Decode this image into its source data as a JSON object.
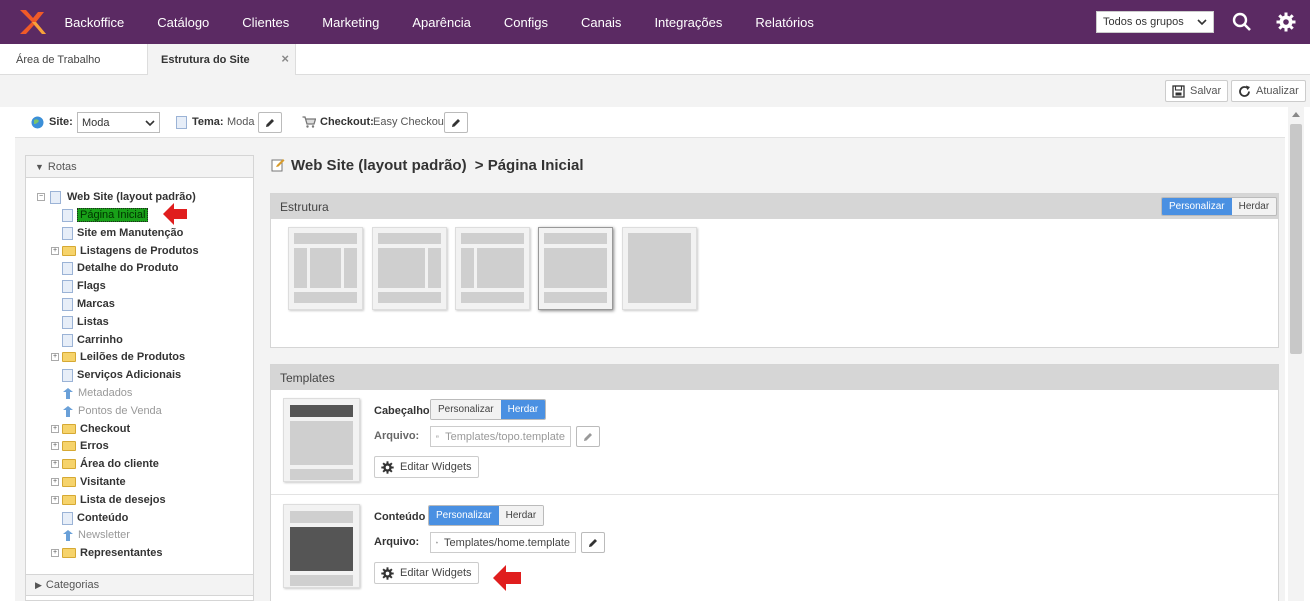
{
  "nav": {
    "brand": "Backoffice",
    "items": [
      "Catálogo",
      "Clientes",
      "Marketing",
      "Aparência",
      "Configs",
      "Canais",
      "Integrações",
      "Relatórios"
    ],
    "group_select": "Todos os grupos"
  },
  "tabs": {
    "home": "Área de Trabalho",
    "active": "Estrutura do Site",
    "close": "×"
  },
  "toolbar": {
    "save": "Salvar",
    "refresh": "Atualizar"
  },
  "sitebar": {
    "site_label": "Site:",
    "site_value": "Moda",
    "theme_label": "Tema:",
    "theme_value": "Moda",
    "checkout_label": "Checkout:",
    "checkout_value": "Easy Checkout"
  },
  "left": {
    "routes_label": "Rotas",
    "categories_label": "Categorias",
    "root": "Web Site (layout padrão)",
    "items": [
      {
        "label": "Página Inicial",
        "icon": "page",
        "selected": true
      },
      {
        "label": "Site em Manutenção",
        "icon": "page"
      },
      {
        "label": "Listagens de Produtos",
        "icon": "folder",
        "expandable": true
      },
      {
        "label": "Detalhe do Produto",
        "icon": "page"
      },
      {
        "label": "Flags",
        "icon": "page"
      },
      {
        "label": "Marcas",
        "icon": "page"
      },
      {
        "label": "Listas",
        "icon": "page"
      },
      {
        "label": "Carrinho",
        "icon": "page"
      },
      {
        "label": "Leilões de Produtos",
        "icon": "folder",
        "expandable": true
      },
      {
        "label": "Serviços Adicionais",
        "icon": "page"
      },
      {
        "label": "Metadados",
        "icon": "arrow",
        "disabled": true
      },
      {
        "label": "Pontos de Venda",
        "icon": "arrow",
        "disabled": true
      },
      {
        "label": "Checkout",
        "icon": "folder",
        "expandable": true
      },
      {
        "label": "Erros",
        "icon": "folder",
        "expandable": true
      },
      {
        "label": "Área do cliente",
        "icon": "folder",
        "expandable": true
      },
      {
        "label": "Visitante",
        "icon": "folder",
        "expandable": true
      },
      {
        "label": "Lista de desejos",
        "icon": "folder",
        "expandable": true
      },
      {
        "label": "Conteúdo",
        "icon": "page"
      },
      {
        "label": "Newsletter",
        "icon": "arrow",
        "disabled": true
      },
      {
        "label": "Representantes",
        "icon": "folder",
        "expandable": true
      }
    ]
  },
  "main": {
    "title_site": "Web Site (layout padrão)",
    "title_sep": ">",
    "title_page": "Página Inicial",
    "structure": {
      "title": "Estrutura",
      "customize": "Personalizar",
      "inherit": "Herdar"
    },
    "templates": {
      "title": "Templates",
      "file_label": "Arquivo:",
      "edit_widgets": "Editar Widgets",
      "customize": "Personalizar",
      "inherit": "Herdar",
      "header": {
        "name": "Cabeçalho",
        "file": "Templates/topo.template"
      },
      "content": {
        "name": "Conteúdo",
        "file": "Templates/home.template"
      }
    }
  },
  "colors": {
    "topbar": "#5b2a63",
    "accent": "#4a90e2",
    "selected": "#18a018",
    "arrow": "#e01e1e"
  }
}
